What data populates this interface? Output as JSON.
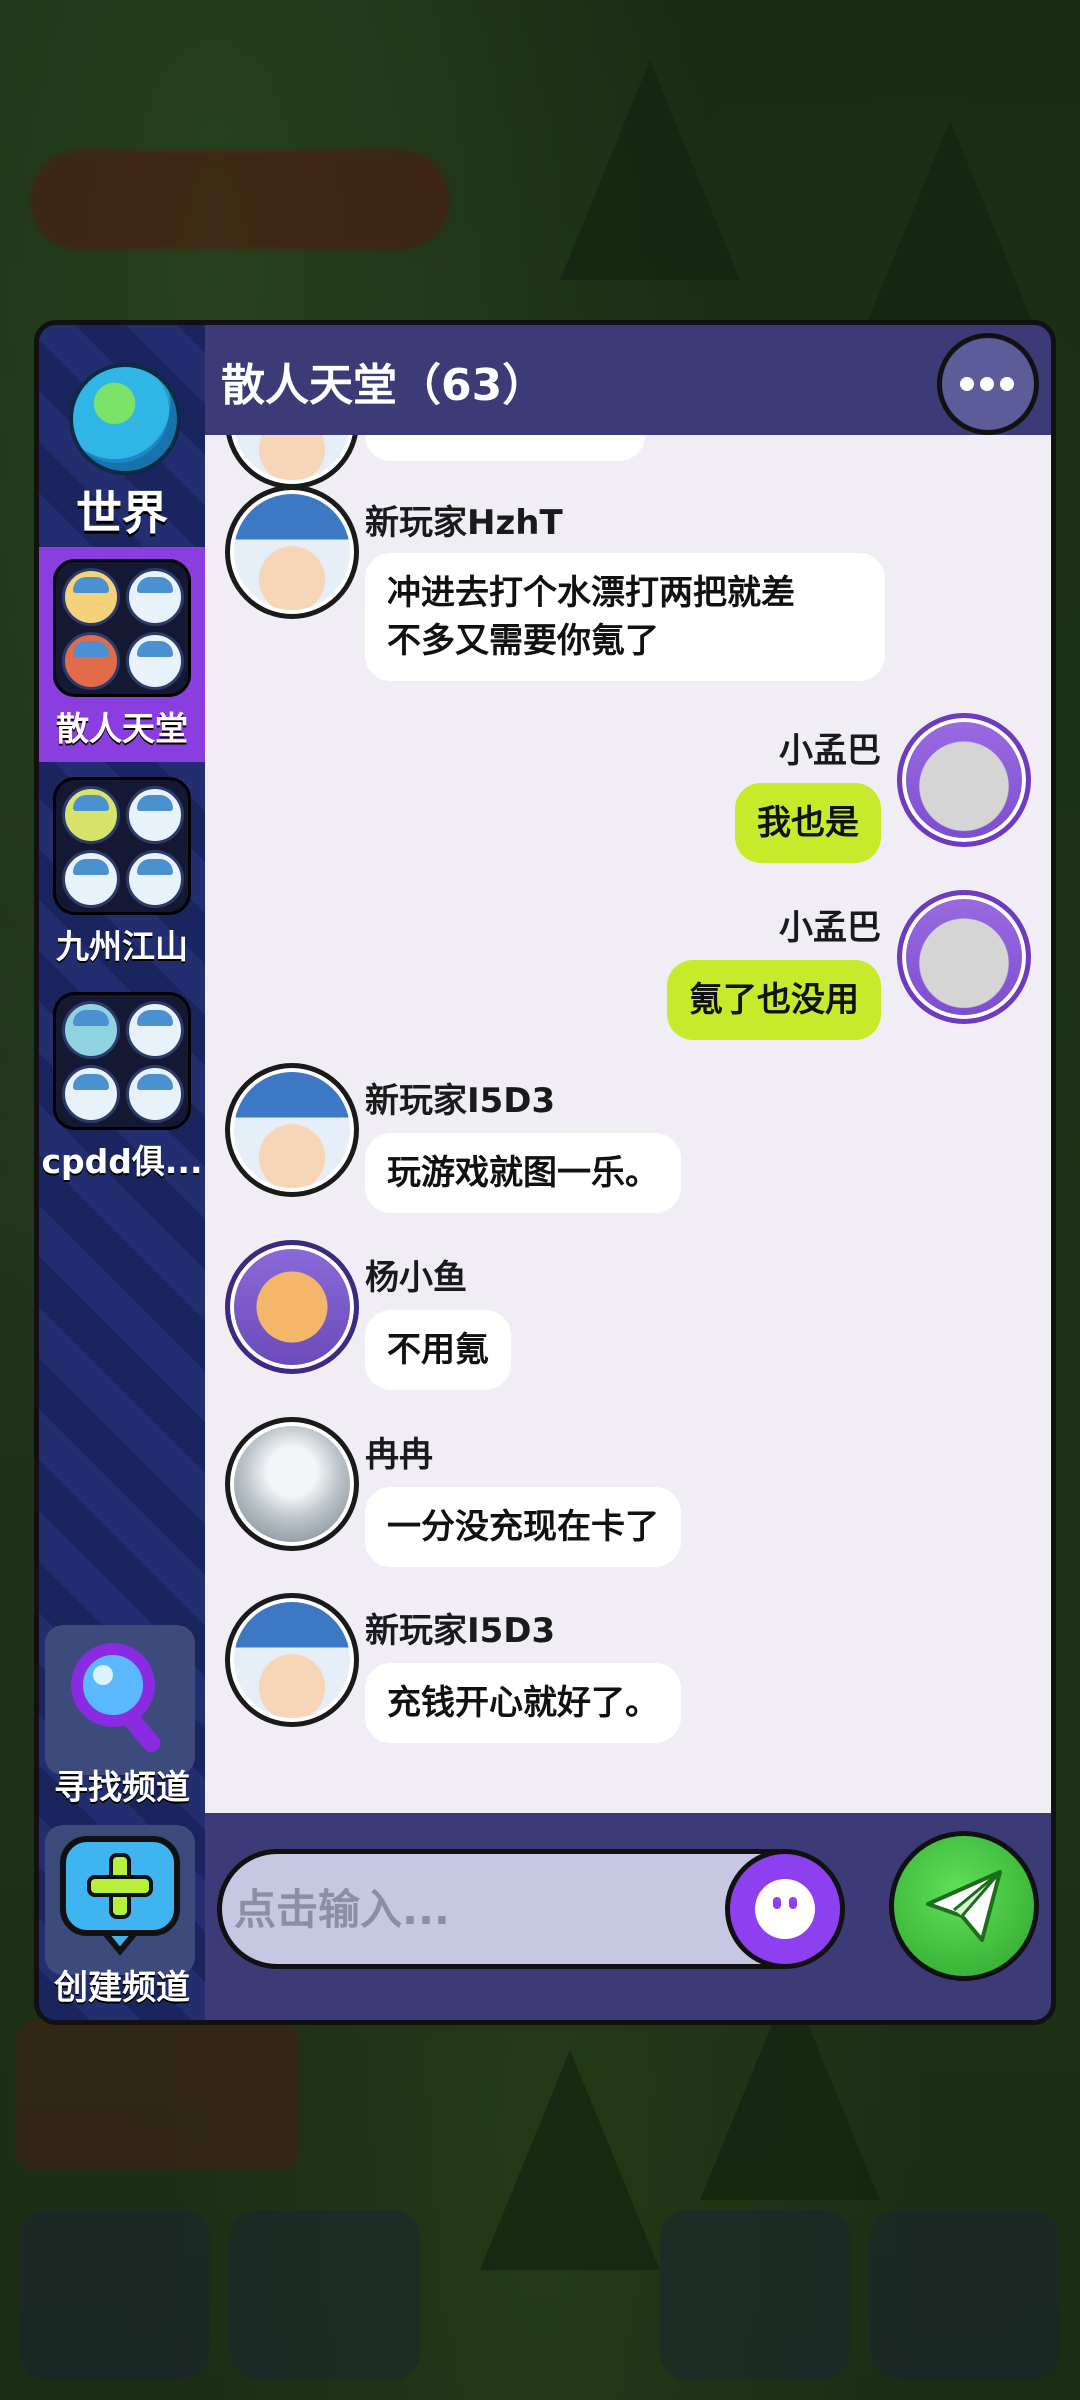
{
  "sidebar": {
    "world_label": "世界",
    "channels": [
      {
        "label": "散人天堂",
        "active": true
      },
      {
        "label": "九州江山",
        "active": false
      },
      {
        "label": "cpdd俱...",
        "active": false
      }
    ],
    "find_channel": "寻找频道",
    "create_channel": "创建频道"
  },
  "header": {
    "title": "散人天堂（63）"
  },
  "messages": [
    {
      "user": "新玩家HzhT",
      "text_line1": "冲进去打个水漂打两把就差",
      "text_line2": "不多又需要你氪了",
      "mine": false
    },
    {
      "user": "小孟巴",
      "text": "我也是",
      "mine": true
    },
    {
      "user": "小孟巴",
      "text": "氪了也没用",
      "mine": true
    },
    {
      "user": "新玩家I5D3",
      "text": "玩游戏就图一乐。",
      "mine": false
    },
    {
      "user": "杨小鱼",
      "text": "不用氪",
      "mine": false
    },
    {
      "user": "冉冉",
      "text": "一分没充现在卡了",
      "mine": false
    },
    {
      "user": "新玩家I5D3",
      "text": "充钱开心就好了。",
      "mine": false
    }
  ],
  "input": {
    "placeholder": "点击输入..."
  },
  "colors": {
    "sidebar_active": "#8b3ee0",
    "my_bubble": "#c7ea2a",
    "send_button": "#3fc23a",
    "emoji_button": "#8e3ff0"
  },
  "icons": [
    "world-globe-icon",
    "more-icon",
    "search-magnifier-icon",
    "add-channel-icon",
    "emoji-icon",
    "send-icon"
  ]
}
